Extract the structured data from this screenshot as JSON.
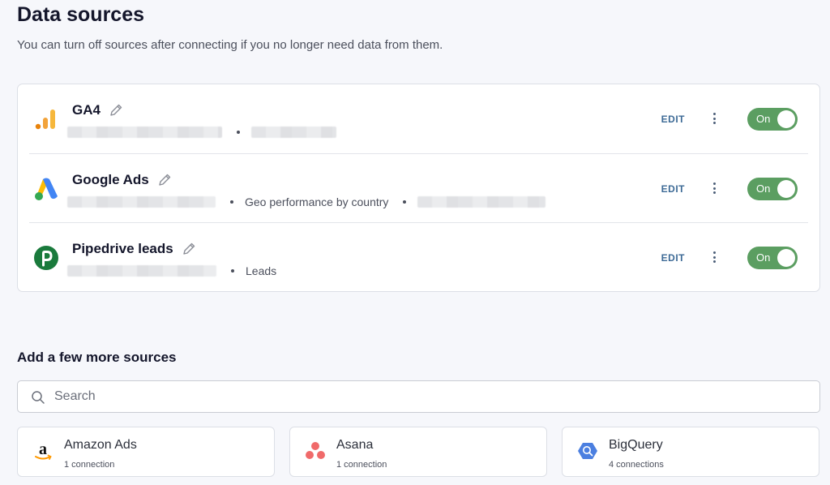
{
  "header": {
    "title": "Data sources",
    "subtitle": "You can turn off sources after connecting if you no longer need data from them."
  },
  "sources": [
    {
      "name": "GA4",
      "icon": "ga4-icon",
      "details": [],
      "edit_label": "EDIT",
      "toggle_label": "On",
      "enabled": true
    },
    {
      "name": "Google Ads",
      "icon": "google-ads-icon",
      "details": [
        "Geo performance by country"
      ],
      "edit_label": "EDIT",
      "toggle_label": "On",
      "enabled": true
    },
    {
      "name": "Pipedrive leads",
      "icon": "pipedrive-icon",
      "details": [
        "Leads"
      ],
      "edit_label": "EDIT",
      "toggle_label": "On",
      "enabled": true
    }
  ],
  "more_sources": {
    "heading": "Add a few more sources",
    "search_placeholder": "Search",
    "search_value": "",
    "items": [
      {
        "name": "Amazon Ads",
        "connections": "1 connection",
        "icon": "amazon-icon"
      },
      {
        "name": "Asana",
        "connections": "1 connection",
        "icon": "asana-icon"
      },
      {
        "name": "BigQuery",
        "connections": "4 connections",
        "icon": "bigquery-icon"
      }
    ]
  },
  "colors": {
    "toggle_on": "#5b9e61",
    "edit_link": "#3d6a96",
    "ga4_orange": "#e8830c",
    "google_blue": "#4285f4",
    "google_yellow": "#fbbc04",
    "google_green": "#34a853",
    "pipedrive_green": "#1a7a3c",
    "asana_coral": "#f06a6a",
    "bigquery_blue": "#4b7fe0"
  }
}
